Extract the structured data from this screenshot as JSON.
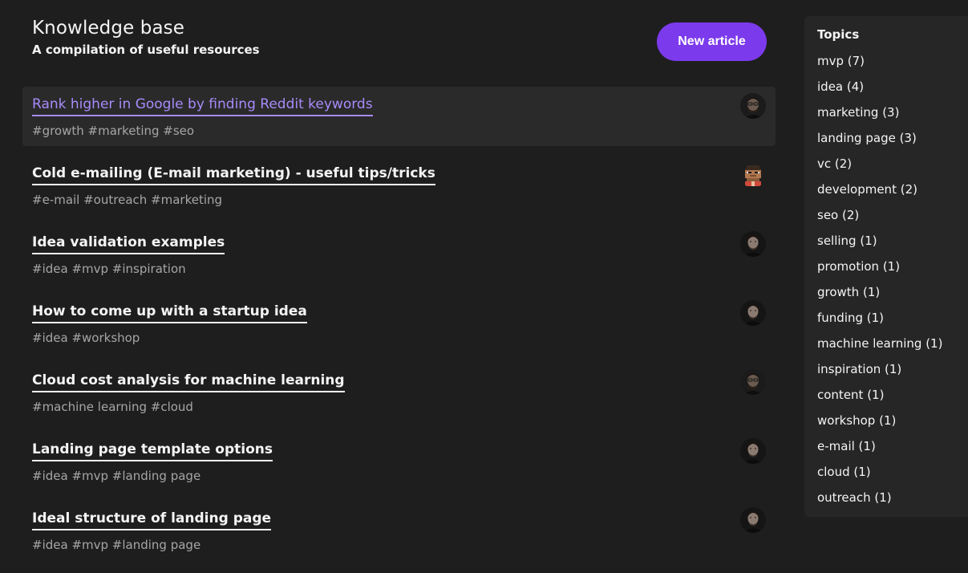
{
  "header": {
    "title": "Knowledge base",
    "subtitle": "A compilation of useful resources",
    "new_article_label": "New article"
  },
  "articles": [
    {
      "title": "Rank higher in Google by finding Reddit keywords",
      "tags": "#growth #marketing #seo",
      "avatar": "man-dark-photo-avatar"
    },
    {
      "title": "Cold e-mailing (E-mail marketing) - useful tips/tricks",
      "tags": "#e-mail #outreach #marketing",
      "avatar": "pixel-art-avatar"
    },
    {
      "title": "Idea validation examples",
      "tags": "#idea #mvp #inspiration",
      "avatar": "man-dark-photo-avatar"
    },
    {
      "title": "How to come up with a startup idea",
      "tags": "#idea #workshop",
      "avatar": "man-dark-photo-avatar"
    },
    {
      "title": "Cloud cost analysis for machine learning",
      "tags": "#machine learning #cloud",
      "avatar": "man-dark-photo-avatar"
    },
    {
      "title": "Landing page template options",
      "tags": "#idea #mvp #landing page",
      "avatar": "man-dark-photo-avatar"
    },
    {
      "title": "Ideal structure of landing page",
      "tags": "#idea #mvp #landing page",
      "avatar": "man-dark-photo-avatar"
    }
  ],
  "topics": {
    "title": "Topics",
    "items": [
      "mvp (7)",
      "idea (4)",
      "marketing (3)",
      "landing page (3)",
      "vc (2)",
      "development (2)",
      "seo (2)",
      "selling (1)",
      "promotion (1)",
      "growth (1)",
      "funding (1)",
      "machine learning (1)",
      "inspiration (1)",
      "content (1)",
      "workshop (1)",
      "e-mail (1)",
      "cloud (1)",
      "outreach (1)"
    ]
  },
  "colors": {
    "background": "#1e1e1e",
    "accent": "#7c3aed",
    "link_highlight": "#a78bfa",
    "tag_text": "#a6a6a6"
  }
}
